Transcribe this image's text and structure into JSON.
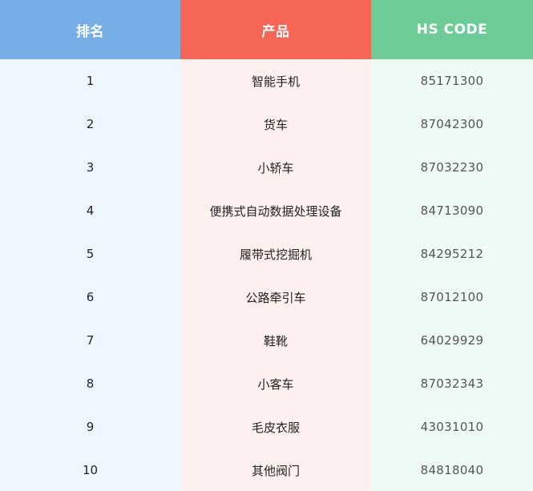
{
  "headers": {
    "rank": "排名",
    "product": "产品",
    "hs_code": "HS CODE"
  },
  "rows": [
    {
      "rank": "1",
      "product": "智能手机",
      "hs_code": "85171300"
    },
    {
      "rank": "2",
      "product": "货车",
      "hs_code": "87042300"
    },
    {
      "rank": "3",
      "product": "小轿车",
      "hs_code": "87032230"
    },
    {
      "rank": "4",
      "product": "便携式自动数据处理设备",
      "hs_code": "84713090"
    },
    {
      "rank": "5",
      "product": "履带式挖掘机",
      "hs_code": "84295212"
    },
    {
      "rank": "6",
      "product": "公路牵引车",
      "hs_code": "87012100"
    },
    {
      "rank": "7",
      "product": "鞋靴",
      "hs_code": "64029929"
    },
    {
      "rank": "8",
      "product": "小客车",
      "hs_code": "87032343"
    },
    {
      "rank": "9",
      "product": "毛皮衣服",
      "hs_code": "43031010"
    },
    {
      "rank": "10",
      "product": "其他阀门",
      "hs_code": "84818040"
    }
  ],
  "colors": {
    "header_rank": "#78aee8",
    "header_product": "#f56656",
    "header_code": "#6dcb98",
    "col_rank_bg": "#eef7ff",
    "col_product_bg": "#fff0f0",
    "col_code_bg": "#eefbf4"
  }
}
